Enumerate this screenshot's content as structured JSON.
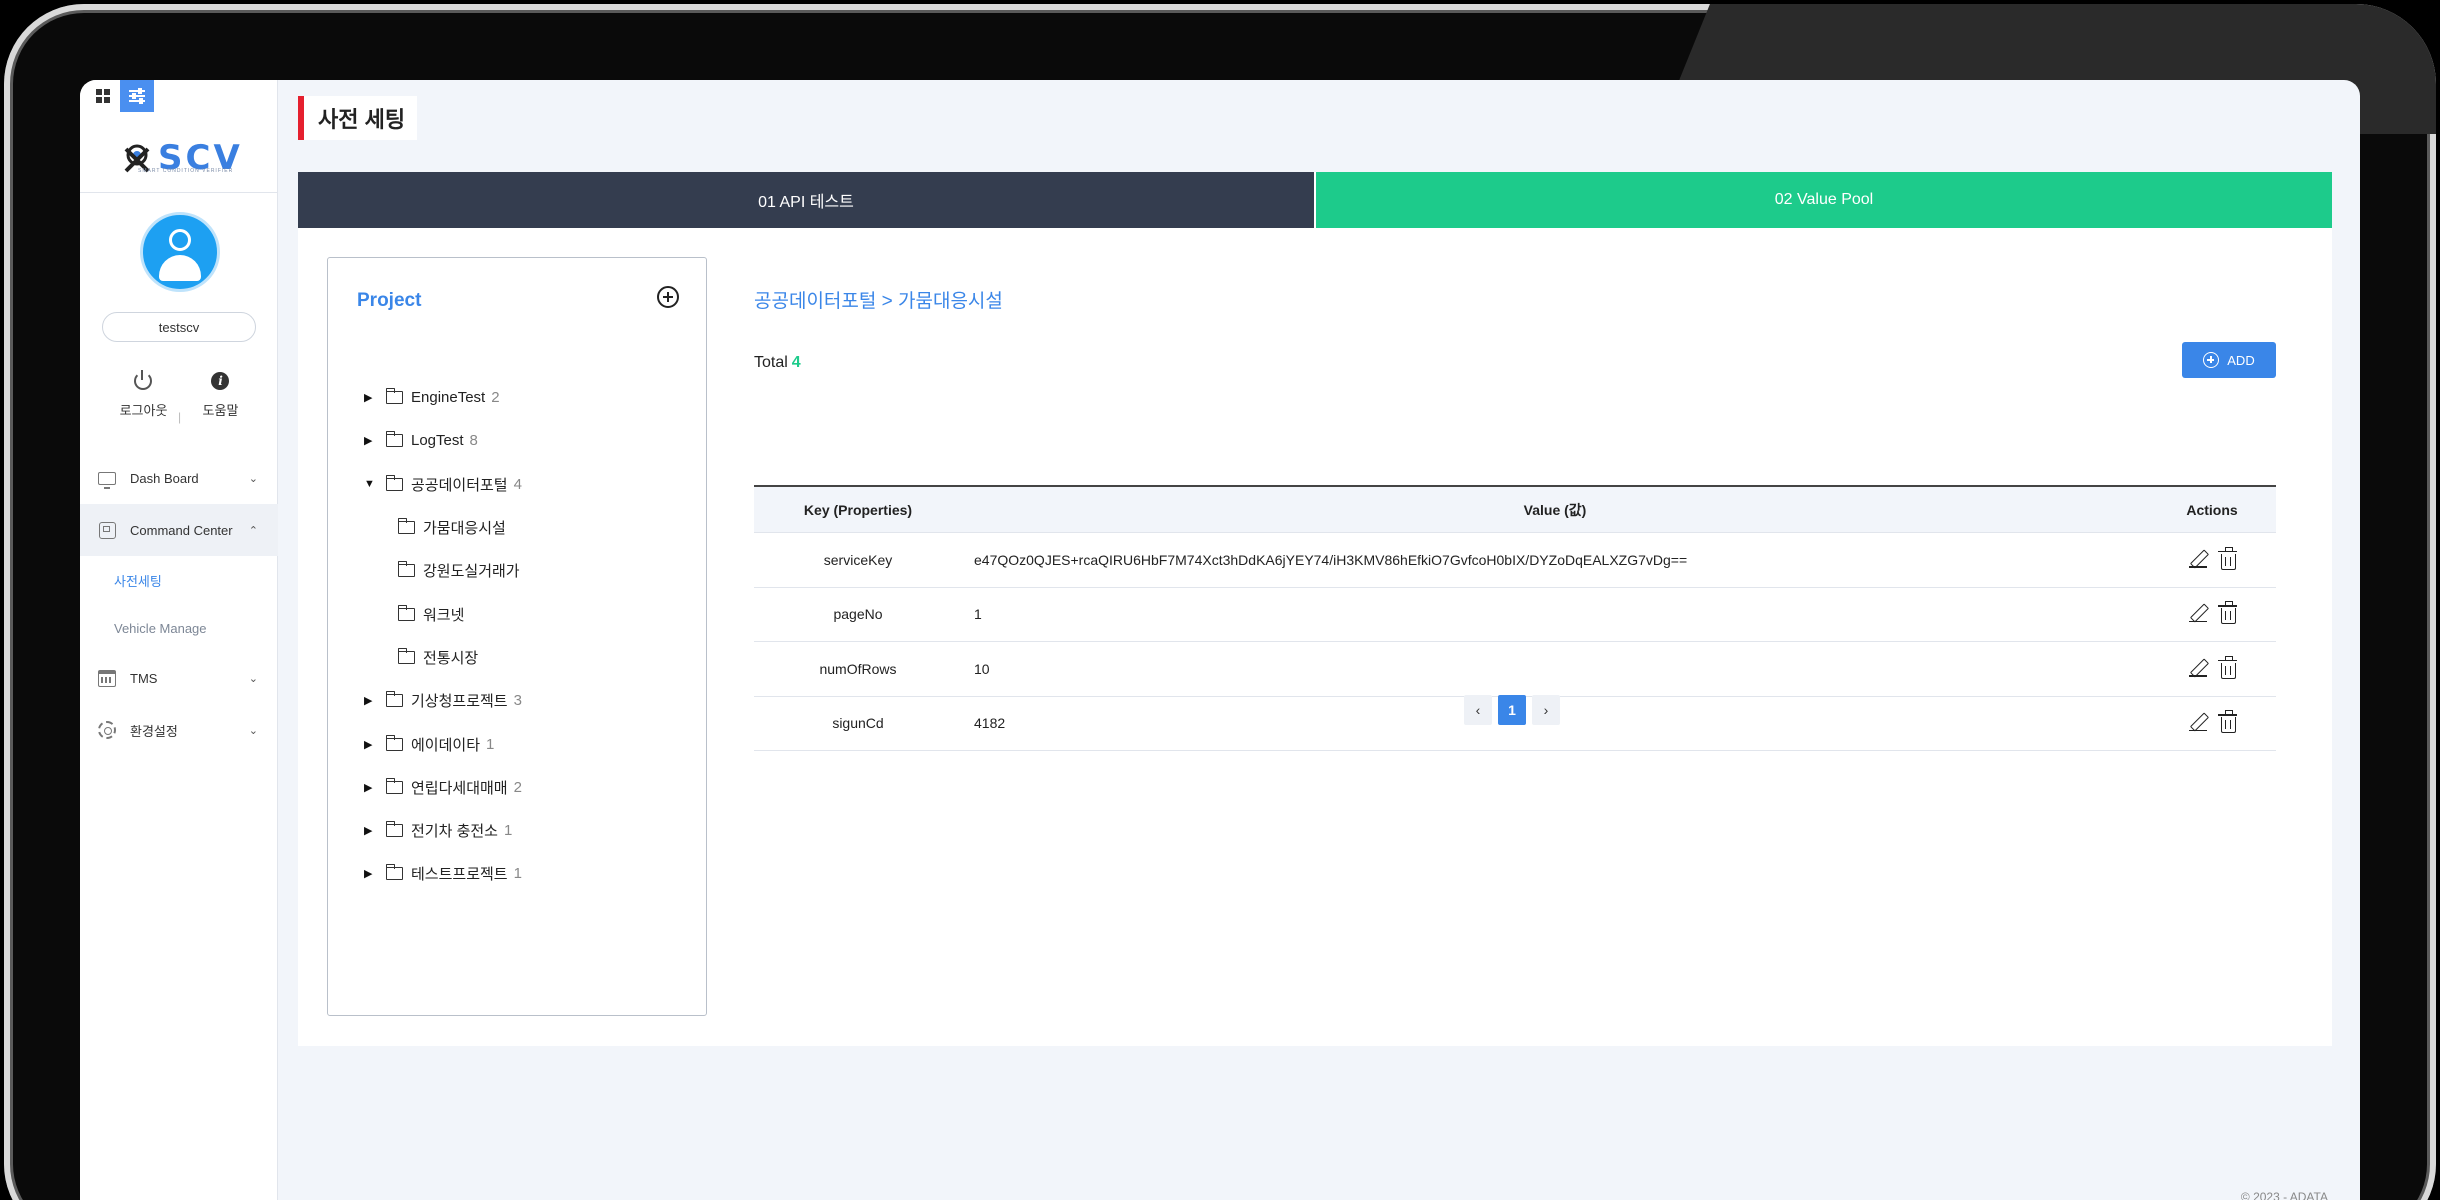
{
  "sidebar": {
    "logo_text": "SCV",
    "logo_subtitle": "SMART CONDITION VERIFIER",
    "username": "testscv",
    "logout_label": "로그아웃",
    "separator": "|",
    "help_label": "도움말",
    "nav": {
      "dashboard": "Dash Board",
      "command_center": "Command Center",
      "sub_presetting": "사전세팅",
      "sub_vehicle": "Vehicle Manage",
      "tms": "TMS",
      "settings": "환경설정"
    }
  },
  "page": {
    "title": "사전 세팅",
    "steps": [
      "01 API 테스트",
      "02 Value Pool"
    ]
  },
  "project": {
    "title": "Project",
    "tree": [
      {
        "name": "EngineTest",
        "count": "2"
      },
      {
        "name": "LogTest",
        "count": "8"
      },
      {
        "name": "공공데이터포털",
        "count": "4"
      },
      {
        "name": "가뭄대응시설"
      },
      {
        "name": "강원도실거래가"
      },
      {
        "name": "워크넷"
      },
      {
        "name": "전통시장"
      },
      {
        "name": "기상청프로젝트",
        "count": "3"
      },
      {
        "name": "에이데이타",
        "count": "1"
      },
      {
        "name": "연립다세대매매",
        "count": "2"
      },
      {
        "name": "전기차 충전소",
        "count": "1"
      },
      {
        "name": "테스트프로젝트",
        "count": "1"
      }
    ]
  },
  "content": {
    "breadcrumb": "공공데이터포털 > 가뭄대응시설",
    "total_label": "Total",
    "total_count": "4",
    "add_label": "ADD",
    "columns": {
      "key": "Key (Properties)",
      "value": "Value (값)",
      "actions": "Actions"
    },
    "rows": [
      {
        "key": "serviceKey",
        "value": "e47QOz0QJES+rcaQIRU6HbF7M74Xct3hDdKA6jYEY74/iH3KMV86hEfkiO7GvfcoH0bIX/DYZoDqEALXZG7vDg=="
      },
      {
        "key": "pageNo",
        "value": "1"
      },
      {
        "key": "numOfRows",
        "value": "10"
      },
      {
        "key": "sigunCd",
        "value": "4182"
      }
    ],
    "pager": {
      "prev": "‹",
      "current": "1",
      "next": "›"
    }
  },
  "footer": "© 2023 - ADATA",
  "colors": {
    "accent": "#3a86e8",
    "step_dark": "#343d4f",
    "step_green": "#1dcb8b",
    "title_bar": "#e5202e"
  }
}
